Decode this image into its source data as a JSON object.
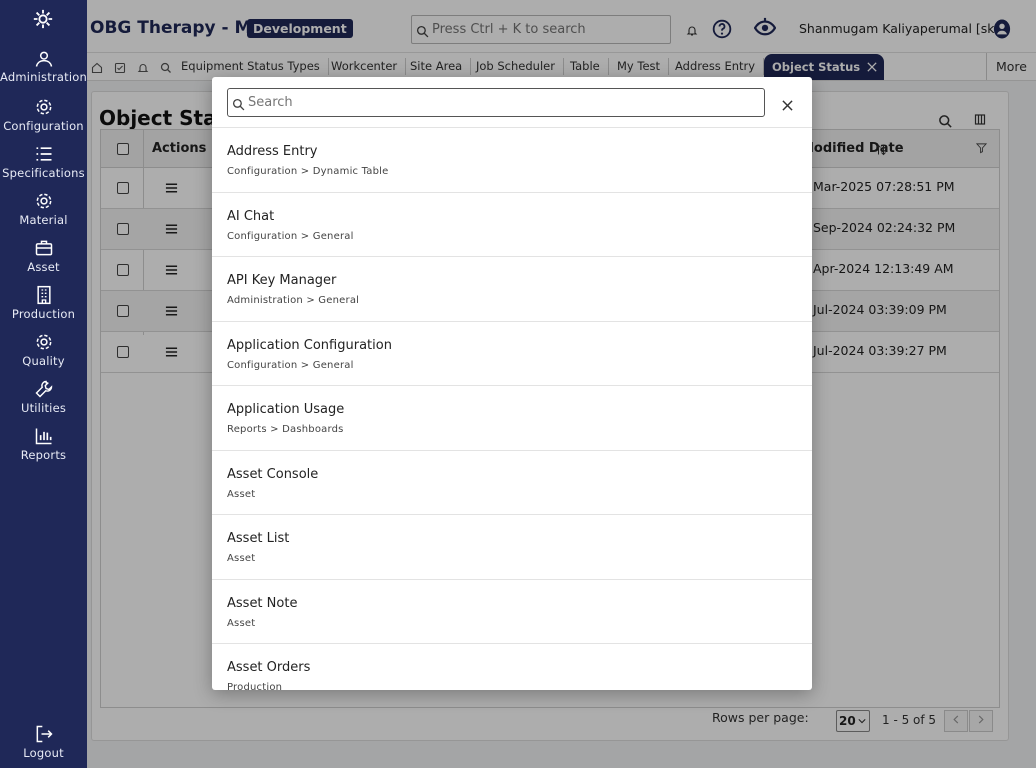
{
  "sidebar": {
    "items": [
      {
        "label": "Administration",
        "icon": "users-icon"
      },
      {
        "label": "Configuration",
        "icon": "gear-icon"
      },
      {
        "label": "Specifications",
        "icon": "list-icon"
      },
      {
        "label": "Material",
        "icon": "gear-icon"
      },
      {
        "label": "Asset",
        "icon": "briefcase-icon"
      },
      {
        "label": "Production",
        "icon": "building-icon"
      },
      {
        "label": "Quality",
        "icon": "gear-icon"
      },
      {
        "label": "Utilities",
        "icon": "wrench-icon"
      },
      {
        "label": "Reports",
        "icon": "bar-chart-icon"
      }
    ],
    "logout_label": "Logout"
  },
  "header": {
    "title": "OBG Therapy - MD",
    "env_badge": "Development",
    "search_placeholder": "Press Ctrl + K to search",
    "user_name": "Shanmugam Kaliyaperumal [sk]"
  },
  "tabs": {
    "items": [
      "Equipment Status Types",
      "Workcenter",
      "Site Area",
      "Job Scheduler",
      "Table",
      "My Test",
      "Address Entry"
    ],
    "active": "Object Status",
    "more_label": "More"
  },
  "main": {
    "title": "Object Status",
    "columns": {
      "actions": "Actions",
      "modified": "Modified Date"
    },
    "rows": [
      {
        "date": "Mar-2025 07:28:51 PM"
      },
      {
        "date": "Sep-2024 02:24:32 PM"
      },
      {
        "date": "Apr-2024 12:13:49 AM"
      },
      {
        "date": "Jul-2024 03:39:09 PM"
      },
      {
        "date": "Jul-2024 03:39:27 PM"
      }
    ],
    "pager": {
      "rows_per_page_label": "Rows per page:",
      "rows_per_page": "20",
      "range": "1 - 5 of 5"
    }
  },
  "modal": {
    "search_placeholder": "Search",
    "results": [
      {
        "title": "Address Entry",
        "path": "Configuration > Dynamic Table"
      },
      {
        "title": "AI Chat",
        "path": "Configuration > General"
      },
      {
        "title": "API Key Manager",
        "path": "Administration > General"
      },
      {
        "title": "Application Configuration",
        "path": "Configuration > General"
      },
      {
        "title": "Application Usage",
        "path": "Reports > Dashboards"
      },
      {
        "title": "Asset Console",
        "path": "Asset"
      },
      {
        "title": "Asset List",
        "path": "Asset"
      },
      {
        "title": "Asset Note",
        "path": "Asset"
      },
      {
        "title": "Asset Orders",
        "path": "Production"
      }
    ]
  },
  "colors": {
    "brand": "#1f2858",
    "overlay": "rgba(0,0,0,0.32)"
  }
}
